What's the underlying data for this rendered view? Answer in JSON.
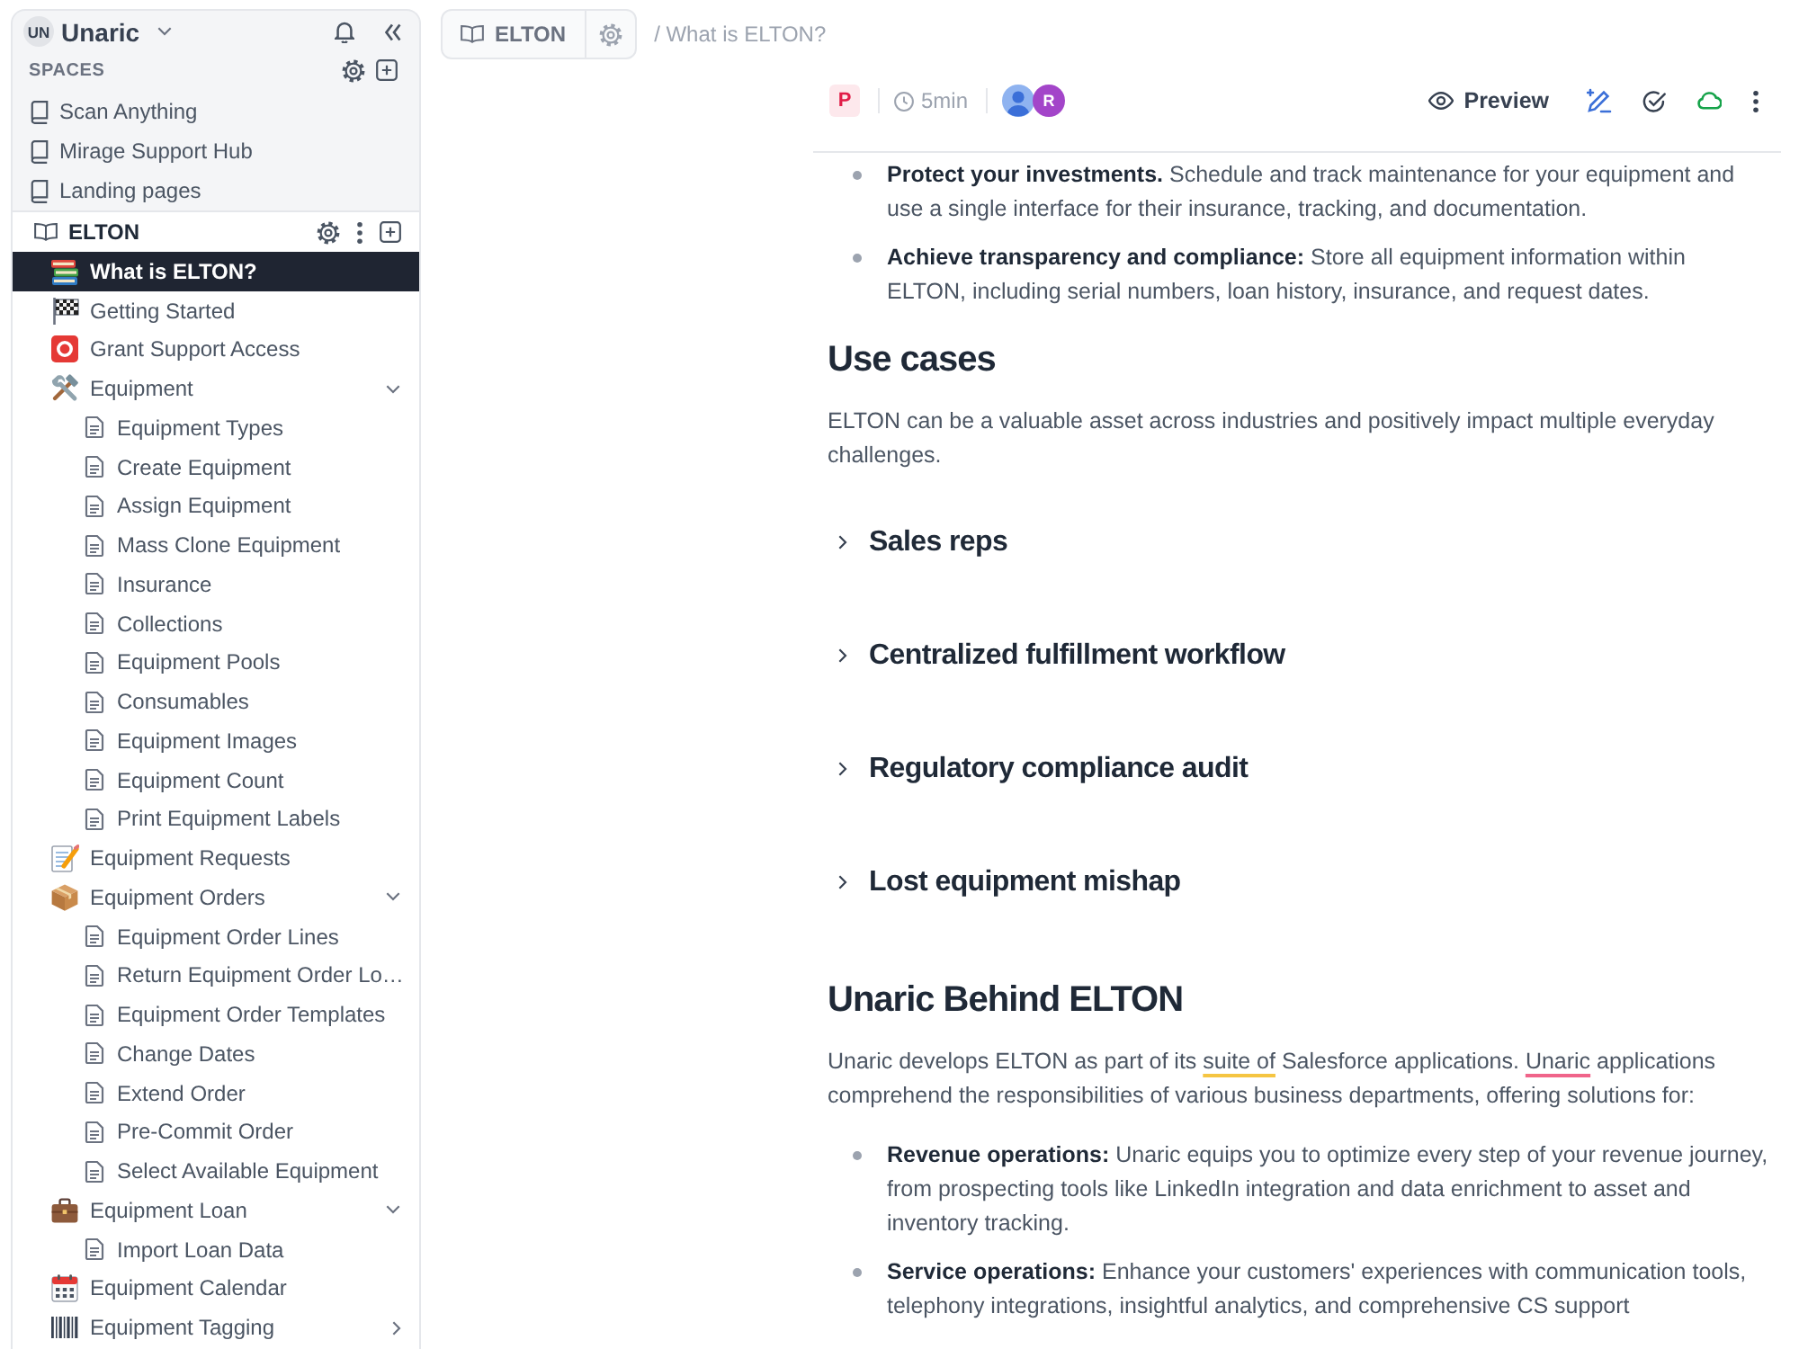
{
  "workspace": {
    "avatar": "UN",
    "name": "Unaric"
  },
  "spaces": {
    "title": "SPACES",
    "items": [
      {
        "label": "Scan Anything"
      },
      {
        "label": "Mirage Support Hub"
      },
      {
        "label": "Landing pages"
      }
    ]
  },
  "current_space": {
    "label": "ELTON",
    "tree": [
      {
        "label": "What is ELTON?",
        "kind": "books",
        "selected": true
      },
      {
        "label": "Getting Started",
        "kind": "flag",
        "selected": false
      },
      {
        "label": "Grant Support Access",
        "kind": "emergency",
        "selected": false
      },
      {
        "label": "Equipment",
        "kind": "tools",
        "selected": false,
        "expanded": true,
        "children": [
          {
            "label": "Equipment Types",
            "kind": "page",
            "selected": false
          },
          {
            "label": "Create Equipment",
            "kind": "page",
            "selected": false
          },
          {
            "label": "Assign Equipment",
            "kind": "page",
            "selected": false
          },
          {
            "label": "Mass Clone Equipment",
            "kind": "page",
            "selected": false
          },
          {
            "label": "Insurance",
            "kind": "page",
            "selected": false
          },
          {
            "label": "Collections",
            "kind": "page",
            "selected": false
          },
          {
            "label": "Equipment Pools",
            "kind": "page",
            "selected": false
          },
          {
            "label": "Consumables",
            "kind": "page",
            "selected": false
          },
          {
            "label": "Equipment Images",
            "kind": "page",
            "selected": false
          },
          {
            "label": "Equipment Count",
            "kind": "page",
            "selected": false
          },
          {
            "label": "Print Equipment Labels",
            "kind": "page",
            "selected": false
          }
        ]
      },
      {
        "label": "Equipment Requests",
        "kind": "memo",
        "selected": false
      },
      {
        "label": "Equipment Orders",
        "kind": "package",
        "selected": false,
        "expanded": true,
        "children": [
          {
            "label": "Equipment Order Lines",
            "kind": "page",
            "selected": false
          },
          {
            "label": "Return Equipment Order Lo…",
            "kind": "page",
            "selected": false
          },
          {
            "label": "Equipment Order Templates",
            "kind": "page",
            "selected": false
          },
          {
            "label": "Change Dates",
            "kind": "page",
            "selected": false
          },
          {
            "label": "Extend Order",
            "kind": "page",
            "selected": false
          },
          {
            "label": "Pre-Commit Order",
            "kind": "page",
            "selected": false
          },
          {
            "label": "Select Available Equipment",
            "kind": "page",
            "selected": false
          }
        ]
      },
      {
        "label": "Equipment Loan",
        "kind": "briefcase",
        "selected": false,
        "expanded": true,
        "children": [
          {
            "label": "Import Loan Data",
            "kind": "page",
            "selected": false
          }
        ]
      },
      {
        "label": "Equipment Calendar",
        "kind": "calendar",
        "selected": false
      },
      {
        "label": "Equipment Tagging",
        "kind": "barcode",
        "selected": false,
        "expanded": false
      }
    ]
  },
  "breadcrumb": {
    "space": "ELTON",
    "page": "/ What is ELTON?"
  },
  "doc_toolbar": {
    "badge": "P",
    "read_time": "5min",
    "avatars": [
      {
        "kind": "user"
      },
      {
        "kind": "initial",
        "initial": "R"
      }
    ],
    "preview": "Preview"
  },
  "content": [
    {
      "kind": "bullets",
      "items": [
        "**Protect your investments.** Schedule and track maintenance for your equipment and use a single interface for their insurance, tracking, and documentation.",
        "**Achieve transparency and compliance:** Store all equipment information within ELTON, including serial numbers, loan history, insurance, and request dates."
      ]
    },
    {
      "kind": "heading",
      "text": "Use cases"
    },
    {
      "kind": "paragraph",
      "segments": [
        {
          "kind": "plain",
          "text": "ELTON can be a valuable asset across industries and positively impact multiple everyday challenges."
        }
      ]
    },
    {
      "kind": "toggle",
      "text": "Sales reps",
      "expanded": false
    },
    {
      "kind": "toggle",
      "text": "Centralized fulfillment workflow",
      "expanded": false
    },
    {
      "kind": "toggle",
      "text": "Regulatory compliance audit",
      "expanded": false
    },
    {
      "kind": "toggle",
      "text": "Lost equipment mishap",
      "expanded": false
    },
    {
      "kind": "heading",
      "text": "Unaric Behind ELTON"
    },
    {
      "kind": "paragraph",
      "segments": [
        {
          "kind": "plain",
          "text": "Unaric develops ELTON as part of its "
        },
        {
          "kind": "grammar",
          "text": "suite of"
        },
        {
          "kind": "plain",
          "text": " Salesforce applications. "
        },
        {
          "kind": "spelling",
          "text": "Unaric"
        },
        {
          "kind": "plain",
          "text": " applications comprehend the responsibilities of various business departments, offering solutions for:"
        }
      ]
    },
    {
      "kind": "bullets",
      "items": [
        "**Revenue operations:** Unaric equips you to optimize every step of your revenue journey, from prospecting tools like LinkedIn integration and data enrichment to asset and inventory tracking.",
        "**Service operations:** Enhance your customers' experiences with communication tools, telephony integrations, insightful analytics, and comprehensive CS support"
      ]
    }
  ]
}
